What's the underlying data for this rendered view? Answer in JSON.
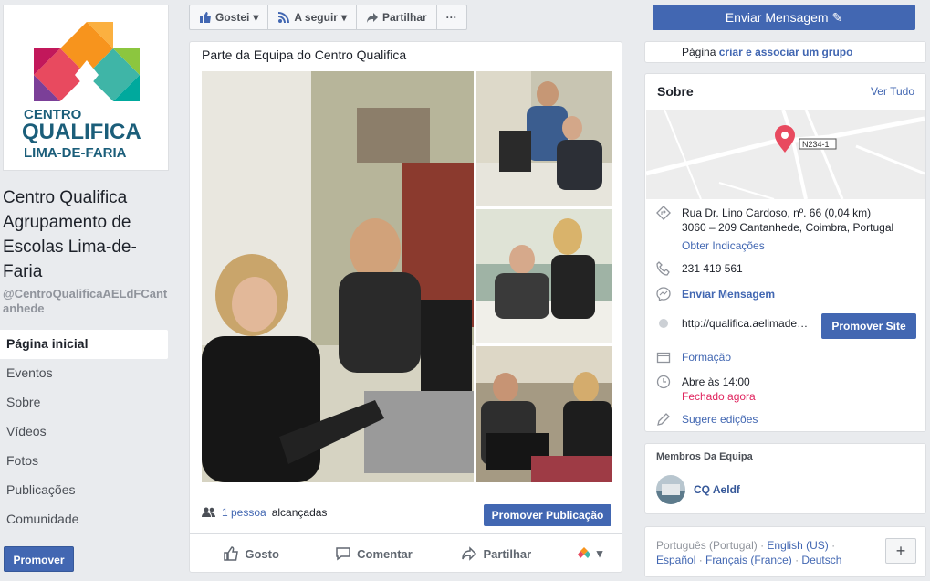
{
  "left": {
    "logo_top": "CENTRO",
    "logo_main": "QUALIFICA",
    "logo_bottom": "LIMA-DE-FARIA",
    "page_name": "Centro Qualifica Agrupamento de Escolas Lima-de-Faria",
    "page_handle": "@CentroQualificaAELdFCantanhede",
    "nav": [
      "Página inicial",
      "Eventos",
      "Sobre",
      "Vídeos",
      "Fotos",
      "Publicações",
      "Comunidade"
    ],
    "promover": "Promover"
  },
  "actionbar": {
    "gostei": "Gostei",
    "seguir": "A seguir",
    "partilhar": "Partilhar",
    "more": "···"
  },
  "enviar_top": "Enviar Mensagem",
  "post": {
    "text": "Parte da Equipa do Centro Qualifica",
    "reach_count": "1 pessoa",
    "reach_label": "alcançadas",
    "promote_button": "Promover Publicação",
    "actions": {
      "gosto": "Gosto",
      "comentar": "Comentar",
      "partilhar": "Partilhar"
    }
  },
  "group_card": {
    "prefix": "Página",
    "link": "criar e associar um grupo"
  },
  "sobre": {
    "title": "Sobre",
    "ver_tudo": "Ver Tudo",
    "map_road": "N234-1",
    "address_1": "Rua Dr. Lino Cardoso, nº. 66 (0,04 km)",
    "address_2": "3060 – 209 Cantanhede, Coimbra, Portugal",
    "directions": "Obter Indicações",
    "phone": "231 419 561",
    "message": "Enviar Mensagem",
    "website": "http://qualifica.aelimade…",
    "promover_site": "Promover Site",
    "category": "Formação",
    "hours": "Abre às 14:00",
    "status": "Fechado agora",
    "suggest": "Sugere edições"
  },
  "membros": {
    "title": "Membros Da Equipa",
    "name": "CQ Aeldf"
  },
  "languages": {
    "current": "Português (Portugal)",
    "l_english": "English (US)",
    "l_espanol": "Español",
    "l_francais": "Français (France)",
    "l_deutsch": "Deutsch",
    "plus": "+"
  },
  "colors": {
    "brand_blue": "#4267b2",
    "closed_red": "#e0245e",
    "pin_red": "#e84a5f"
  }
}
